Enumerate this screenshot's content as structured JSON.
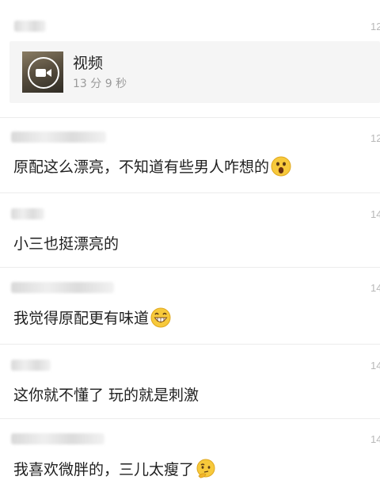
{
  "video": {
    "title": "视频",
    "duration": "13 分 9 秒"
  },
  "comments": [
    {
      "time_partial": "12",
      "text": "原配这么漂亮，不知道有些男人咋想的",
      "emoji": "surprised-face-icon"
    },
    {
      "time_partial": "14",
      "text": "小三也挺漂亮的",
      "emoji": ""
    },
    {
      "time_partial": "14",
      "text": "我觉得原配更有味道",
      "emoji": "grinning-face-icon"
    },
    {
      "time_partial": "14",
      "text": "这你就不懂了 玩的就是刺激",
      "emoji": ""
    },
    {
      "time_partial": "14",
      "text": "我喜欢微胖的，三儿太瘦了",
      "emoji": "thinking-face-icon"
    }
  ],
  "top_time_partial": "12"
}
